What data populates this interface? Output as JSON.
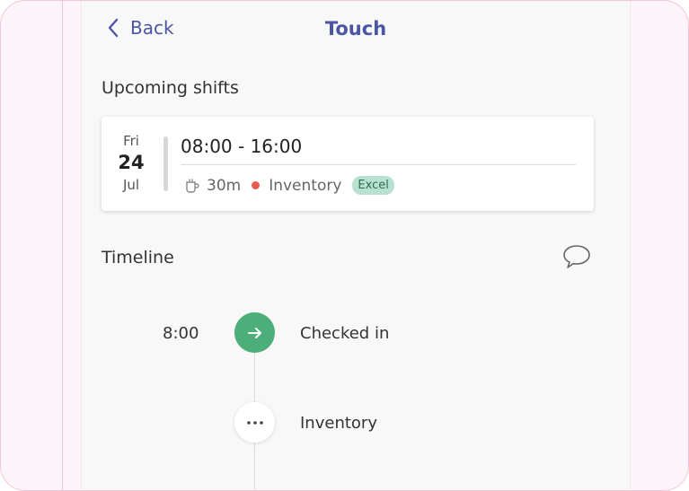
{
  "header": {
    "back_label": "Back",
    "title": "Touch"
  },
  "upcoming": {
    "heading": "Upcoming shifts",
    "shift": {
      "weekday": "Fri",
      "day": "24",
      "month": "Jul",
      "time_range": "08:00 - 16:00",
      "break": "30m",
      "department": "Inventory",
      "badge": "Excel",
      "dot_color": "#ea5b4f"
    }
  },
  "timeline": {
    "heading": "Timeline",
    "items": [
      {
        "time": "8:00",
        "label": "Checked in",
        "icon": "arrow-right-icon"
      },
      {
        "time": "",
        "label": "Inventory",
        "icon": "more-dots-icon"
      }
    ]
  },
  "colors": {
    "accent": "#4b55a5",
    "success": "#4cae78",
    "badge_bg": "#b7e2d1"
  }
}
